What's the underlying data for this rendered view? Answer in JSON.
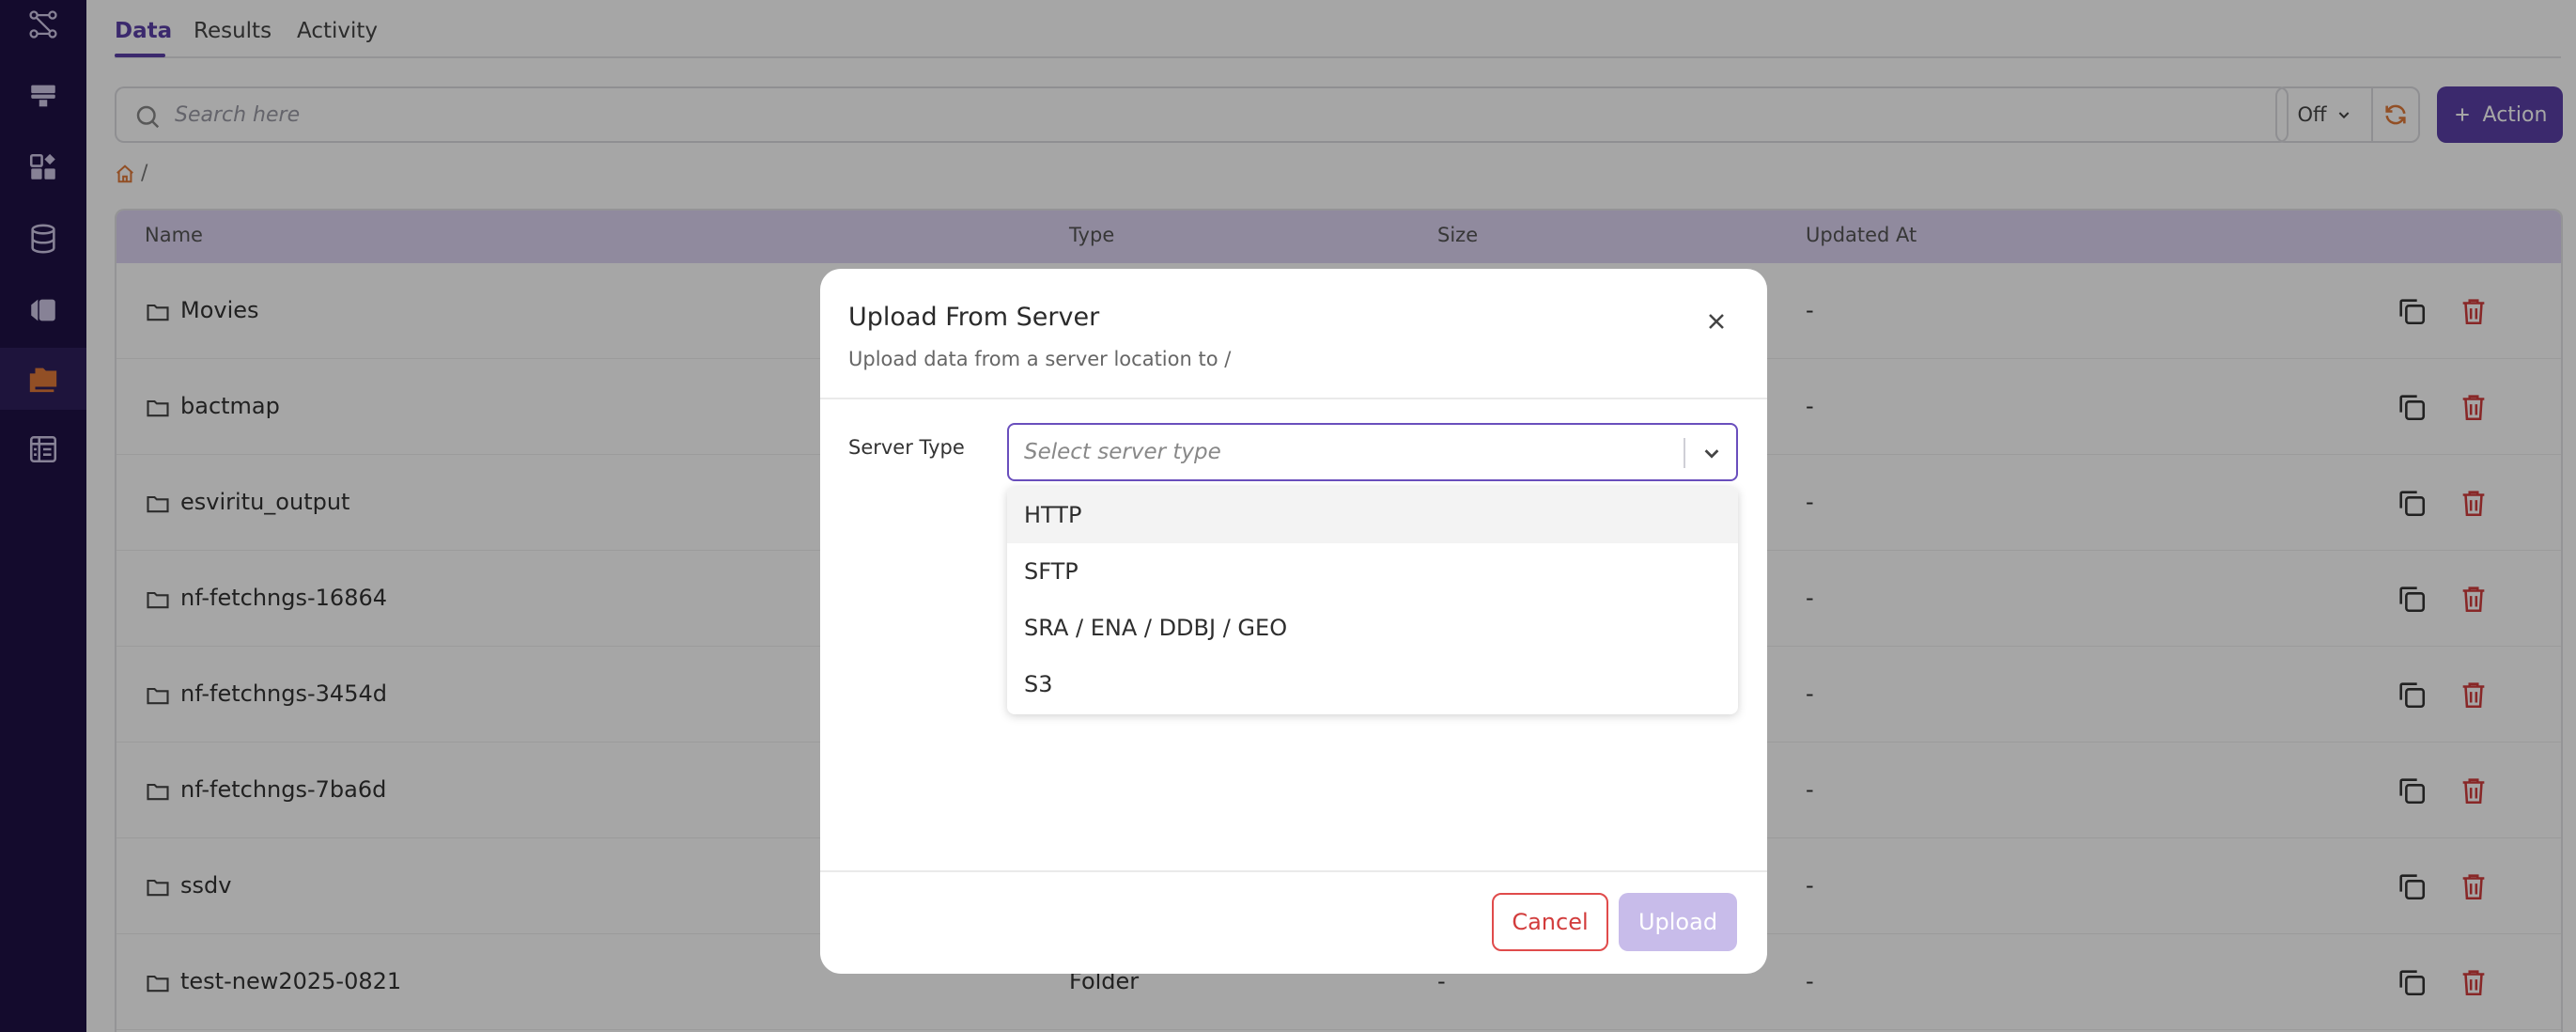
{
  "sidebar": {
    "items": [
      {
        "icon": "workflow-icon"
      },
      {
        "icon": "server-icon"
      },
      {
        "icon": "apps-icon"
      },
      {
        "icon": "database-icon"
      },
      {
        "icon": "tag-icon"
      },
      {
        "icon": "files-icon",
        "active": true
      },
      {
        "icon": "table-icon"
      }
    ],
    "active_color": "#e07a3a"
  },
  "tabs": [
    {
      "label": "Data",
      "active": true
    },
    {
      "label": "Results"
    },
    {
      "label": "Activity"
    }
  ],
  "search": {
    "placeholder": "Search here"
  },
  "toolbar": {
    "toggle_value": "Off",
    "refresh_icon": "refresh-icon",
    "action_label": "Action"
  },
  "breadcrumb": {
    "separator": "/",
    "home_icon": "home-icon"
  },
  "table": {
    "columns": [
      "Name",
      "Type",
      "Size",
      "Updated At"
    ],
    "rows": [
      {
        "name": "Movies",
        "type": "",
        "size": "",
        "updated": "-"
      },
      {
        "name": "bactmap",
        "type": "",
        "size": "",
        "updated": "-"
      },
      {
        "name": "esviritu_output",
        "type": "",
        "size": "",
        "updated": "-"
      },
      {
        "name": "nf-fetchngs-16864",
        "type": "",
        "size": "",
        "updated": "-"
      },
      {
        "name": "nf-fetchngs-3454d",
        "type": "",
        "size": "",
        "updated": "-"
      },
      {
        "name": "nf-fetchngs-7ba6d",
        "type": "",
        "size": "",
        "updated": "-"
      },
      {
        "name": "ssdv",
        "type": "",
        "size": "",
        "updated": "-"
      },
      {
        "name": "test-new2025-0821",
        "type": "Folder",
        "size": "-",
        "updated": "-"
      }
    ]
  },
  "modal": {
    "title": "Upload From Server",
    "subtitle": "Upload data from a server location to /",
    "field_label": "Server Type",
    "select_placeholder": "Select server type",
    "options": [
      "HTTP",
      "SFTP",
      "SRA / ENA / DDBJ / GEO",
      "S3"
    ],
    "cancel_label": "Cancel",
    "upload_label": "Upload"
  },
  "colors": {
    "brand": "#5b3fa8",
    "sidebar_bg": "#1f1146",
    "danger": "#d23c3c",
    "accent": "#e07a3a"
  }
}
